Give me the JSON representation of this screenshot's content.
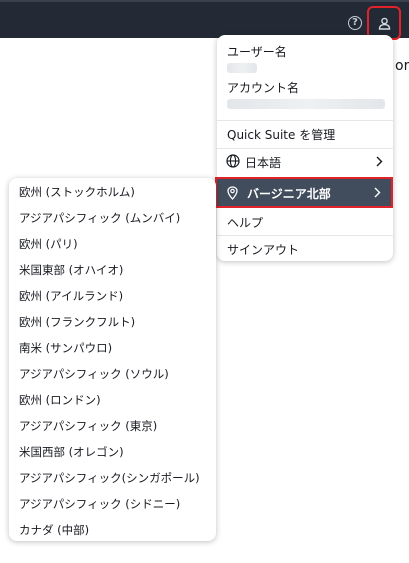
{
  "topbar": {
    "help_icon_glyph": "?",
    "user_icon": "user-icon"
  },
  "background": {
    "partial_text": "ory"
  },
  "account_menu": {
    "username_label": "ユーザー名",
    "account_label": "アカウント名",
    "manage_label": "Quick Suite を管理",
    "language_label": "日本語",
    "region_label": "バージニア北部",
    "help_label": "ヘルプ",
    "signout_label": "サインアウト"
  },
  "region_menu": {
    "items": [
      "欧州 (ストックホルム)",
      "アジアパシフィック (ムンバイ)",
      "欧州 (パリ)",
      "米国東部 (オハイオ)",
      "欧州 (アイルランド)",
      "欧州 (フランクフルト)",
      "南米 (サンパウロ)",
      "アジアパシフィック (ソウル)",
      "欧州 (ロンドン)",
      "アジアパシフィック (東京)",
      "米国西部 (オレゴン)",
      "アジアパシフィック(シンガポール)",
      "アジアパシフィック (シドニー)",
      "カナダ (中部)"
    ]
  },
  "colors": {
    "topbar": "#232a36",
    "highlight_border": "#e0222a",
    "selected_bg": "#414d5c"
  }
}
